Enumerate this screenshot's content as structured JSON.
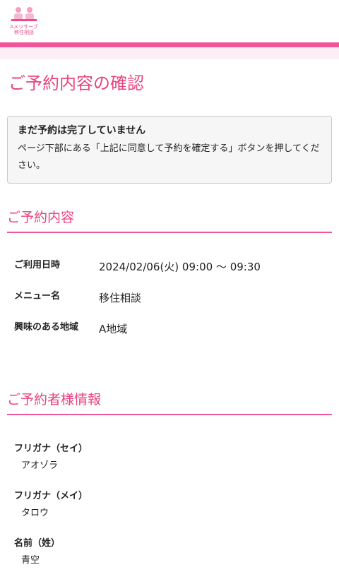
{
  "logo": {
    "line1": "Aメリサーブ",
    "line2": "移住相談"
  },
  "page": {
    "title": "ご予約内容の確認"
  },
  "notice": {
    "title": "まだ予約は完了していません",
    "body": "ページ下部にある「上記に同意して予約を確定する」ボタンを押してください。"
  },
  "reservation": {
    "heading": "ご予約内容",
    "rows": [
      {
        "label": "ご利用日時",
        "value": "2024/02/06(火) 09:00 〜 09:30"
      },
      {
        "label": "メニュー名",
        "value": "移住相談"
      },
      {
        "label": "興味のある地域",
        "value": "A地域"
      }
    ]
  },
  "customer": {
    "heading": "ご予約者様情報",
    "fields": [
      {
        "label": "フリガナ（セイ）",
        "value": "アオゾラ"
      },
      {
        "label": "フリガナ（メイ）",
        "value": "タロウ"
      },
      {
        "label": "名前（姓）",
        "value": "青空"
      }
    ]
  },
  "colors": {
    "accent": "#f2569a",
    "title": "#e8437f",
    "band": "#fdeef5"
  }
}
